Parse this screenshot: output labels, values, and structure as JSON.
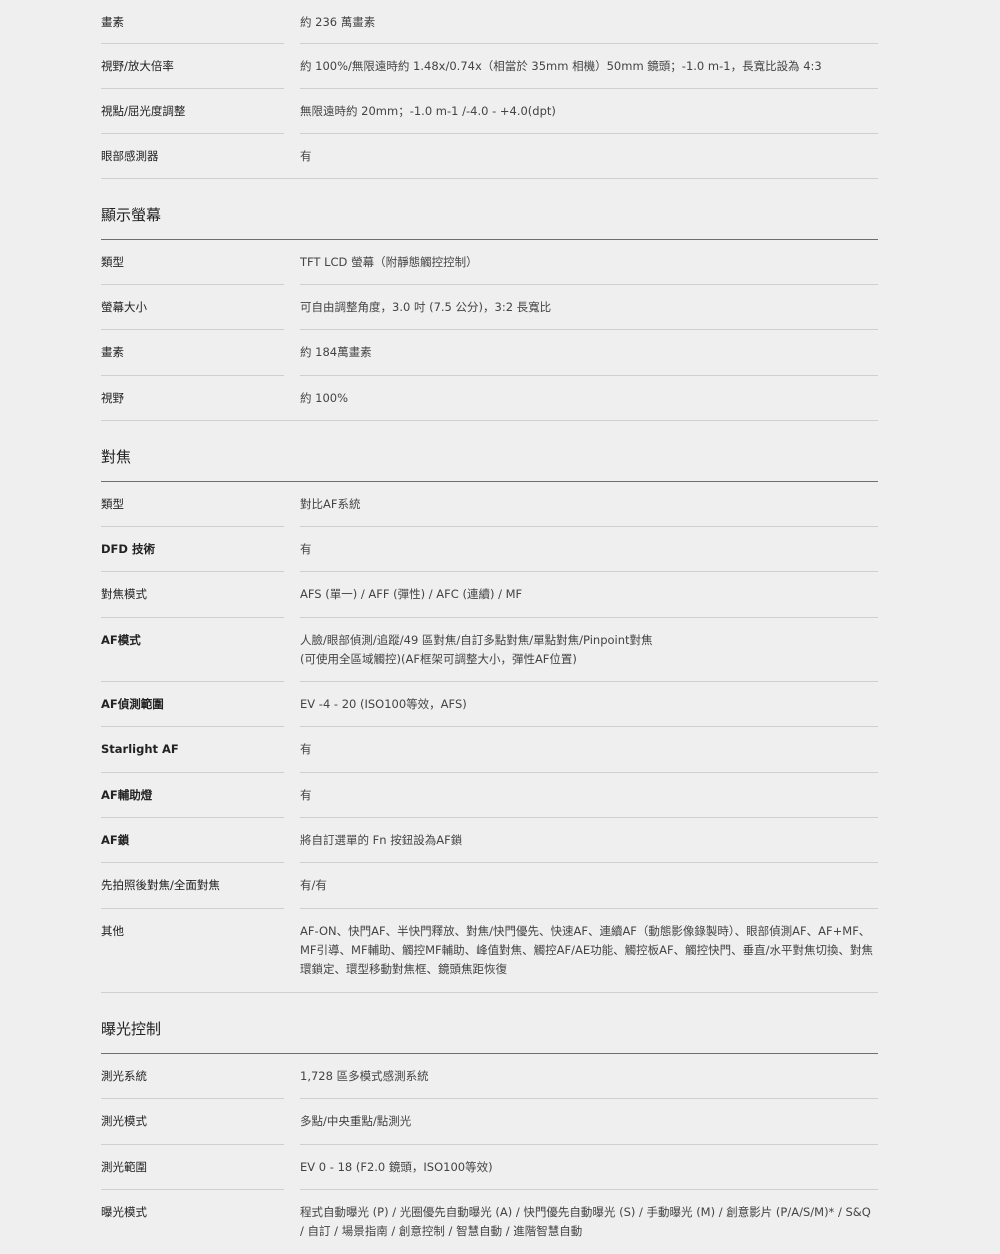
{
  "sections": [
    {
      "title": "",
      "rows": [
        {
          "label": "畫素",
          "value": "約 236 萬畫素",
          "bold": false
        },
        {
          "label": "視野/放大倍率",
          "value": "約 100%/無限遠時約 1.48x/0.74x（相當於 35mm 相機）50mm 鏡頭；-1.0 m-1，長寬比設為 4:3",
          "bold": false
        },
        {
          "label": "視點/屈光度調整",
          "value": "無限遠時約 20mm；-1.0 m-1 /-4.0 - +4.0(dpt)",
          "bold": false
        },
        {
          "label": "眼部感測器",
          "value": "有",
          "bold": false
        }
      ]
    },
    {
      "title": "顯示螢幕",
      "rows": [
        {
          "label": "類型",
          "value": "TFT LCD 螢幕（附靜態觸控控制）",
          "bold": false
        },
        {
          "label": "螢幕大小",
          "value": "可自由調整角度，3.0 吋 (7.5 公分)，3:2 長寬比",
          "bold": false
        },
        {
          "label": "畫素",
          "value": "約 184萬畫素",
          "bold": false
        },
        {
          "label": "視野",
          "value": "約 100%",
          "bold": false
        }
      ]
    },
    {
      "title": "對焦",
      "rows": [
        {
          "label": "類型",
          "value": "對比AF系統",
          "bold": false
        },
        {
          "label": "DFD 技術",
          "value": "有",
          "bold": true
        },
        {
          "label": "對焦模式",
          "value": "AFS (單一) / AFF (彈性) / AFC (連續) / MF",
          "bold": false
        },
        {
          "label": "AF模式",
          "value": "人臉/眼部偵測/追蹤/49 區對焦/自訂多點對焦/單點對焦/Pinpoint對焦\n(可使用全區域觸控)(AF框架可調整大小，彈性AF位置)",
          "bold": true
        },
        {
          "label": "AF偵測範圍",
          "value": "EV -4 - 20 (ISO100等效，AFS)",
          "bold": true
        },
        {
          "label": "Starlight AF",
          "value": "有",
          "bold": true
        },
        {
          "label": "AF輔助燈",
          "value": "有",
          "bold": true
        },
        {
          "label": "AF鎖",
          "value": "將自訂選單的 Fn 按鈕設為AF鎖",
          "bold": true
        },
        {
          "label": "先拍照後對焦/全面對焦",
          "value": "有/有",
          "bold": false
        },
        {
          "label": "其他",
          "value": "AF-ON、快門AF、半快門釋放、對焦/快門優先、快速AF、連續AF（動態影像錄製時）、眼部偵測AF、AF+MF、MF引導、MF輔助、觸控MF輔助、峰值對焦、觸控AF/AE功能、觸控板AF、觸控快門、垂直/水平對焦切換、對焦環鎖定、環型移動對焦框、鏡頭焦距恢復",
          "bold": false
        }
      ]
    },
    {
      "title": "曝光控制",
      "rows": [
        {
          "label": "測光系統",
          "value": "1,728 區多模式感測系統",
          "bold": false
        },
        {
          "label": "測光模式",
          "value": "多點/中央重點/點測光",
          "bold": false
        },
        {
          "label": "測光範圍",
          "value": "EV 0 - 18 (F2.0 鏡頭，ISO100等效)",
          "bold": false
        },
        {
          "label": "曝光模式",
          "value": "程式自動曝光 (P) / 光圈優先自動曝光 (A) / 快門優先自動曝光 (S) / 手動曝光 (M) / 創意影片 (P/A/S/M)* / S&Q / 自訂 / 場景指南 / 創意控制 / 智慧自動 / 進階智慧自動",
          "bold": false
        }
      ]
    }
  ]
}
